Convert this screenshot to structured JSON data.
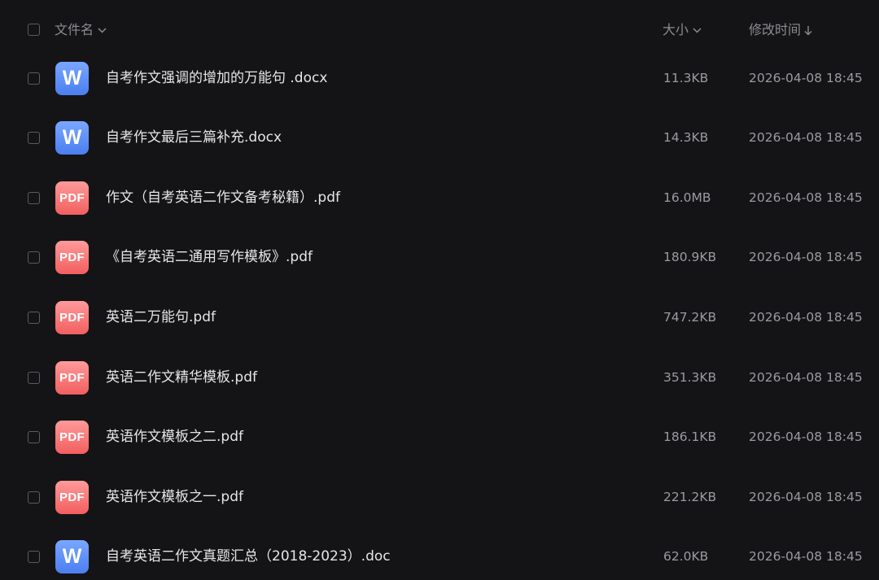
{
  "header": {
    "name_label": "文件名",
    "size_label": "大小",
    "time_label": "修改时间"
  },
  "files": [
    {
      "type": "word",
      "icon_text": "W",
      "name": "自考作文强调的增加的万能句 .docx",
      "size": "11.3KB",
      "modified": "2026-04-08 18:45"
    },
    {
      "type": "word",
      "icon_text": "W",
      "name": "自考作文最后三篇补充.docx",
      "size": "14.3KB",
      "modified": "2026-04-08 18:45"
    },
    {
      "type": "pdf",
      "icon_text": "PDF",
      "name": "作文（自考英语二作文备考秘籍）.pdf",
      "size": "16.0MB",
      "modified": "2026-04-08 18:45"
    },
    {
      "type": "pdf",
      "icon_text": "PDF",
      "name": "《自考英语二通用写作模板》.pdf",
      "size": "180.9KB",
      "modified": "2026-04-08 18:45"
    },
    {
      "type": "pdf",
      "icon_text": "PDF",
      "name": "英语二万能句.pdf",
      "size": "747.2KB",
      "modified": "2026-04-08 18:45"
    },
    {
      "type": "pdf",
      "icon_text": "PDF",
      "name": "英语二作文精华模板.pdf",
      "size": "351.3KB",
      "modified": "2026-04-08 18:45"
    },
    {
      "type": "pdf",
      "icon_text": "PDF",
      "name": "英语作文模板之二.pdf",
      "size": "186.1KB",
      "modified": "2026-04-08 18:45"
    },
    {
      "type": "pdf",
      "icon_text": "PDF",
      "name": "英语作文模板之一.pdf",
      "size": "221.2KB",
      "modified": "2026-04-08 18:45"
    },
    {
      "type": "word",
      "icon_text": "W",
      "name": "自考英语二作文真题汇总（2018-2023）.doc",
      "size": "62.0KB",
      "modified": "2026-04-08 18:45"
    }
  ],
  "colors": {
    "background": "#141416",
    "word_icon": "#5b8ef5",
    "pdf_icon": "#f87474"
  }
}
